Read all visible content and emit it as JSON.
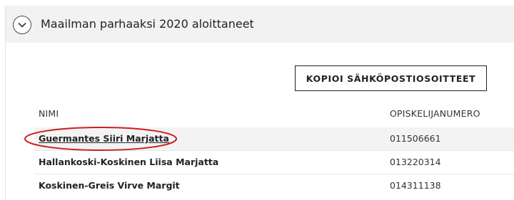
{
  "panel": {
    "title": "Maailman parhaaksi 2020 aloittaneet",
    "toggle_icon": "chevron-down-icon"
  },
  "toolbar": {
    "copy_emails_label": "KOPIOI SÄHKÖPOSTIOSOITTEET"
  },
  "table": {
    "headers": {
      "name": "NIMI",
      "student_number": "OPISKELIJANUMERO"
    },
    "rows": [
      {
        "name": "Guermantes Siiri Marjatta",
        "student_number": "011506661"
      },
      {
        "name": "Hallankoski-Koskinen Liisa Marjatta",
        "student_number": "013220314"
      },
      {
        "name": "Koskinen-Greis Virve Margit",
        "student_number": "014311138"
      }
    ]
  },
  "colors": {
    "header_bg": "#f2f2f2",
    "annotation": "#cc1f1f"
  }
}
